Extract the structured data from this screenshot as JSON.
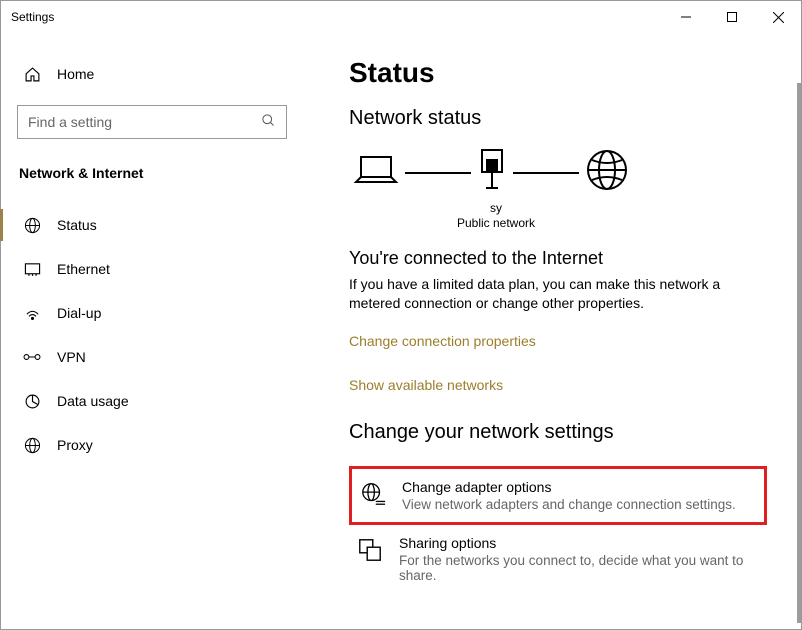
{
  "window": {
    "title": "Settings"
  },
  "sidebar": {
    "home": "Home",
    "search_placeholder": "Find a setting",
    "category": "Network & Internet",
    "items": [
      {
        "label": "Status"
      },
      {
        "label": "Ethernet"
      },
      {
        "label": "Dial-up"
      },
      {
        "label": "VPN"
      },
      {
        "label": "Data usage"
      },
      {
        "label": "Proxy"
      }
    ]
  },
  "content": {
    "title": "Status",
    "status_heading": "Network status",
    "net_name": "sy",
    "net_type": "Public network",
    "connected_heading": "You're connected to the Internet",
    "connected_desc": "If you have a limited data plan, you can make this network a metered connection or change other properties.",
    "link_change_props": "Change connection properties",
    "link_show_networks": "Show available networks",
    "settings_heading": "Change your network settings",
    "options": [
      {
        "title": "Change adapter options",
        "desc": "View network adapters and change connection settings."
      },
      {
        "title": "Sharing options",
        "desc": "For the networks you connect to, decide what you want to share."
      }
    ]
  }
}
